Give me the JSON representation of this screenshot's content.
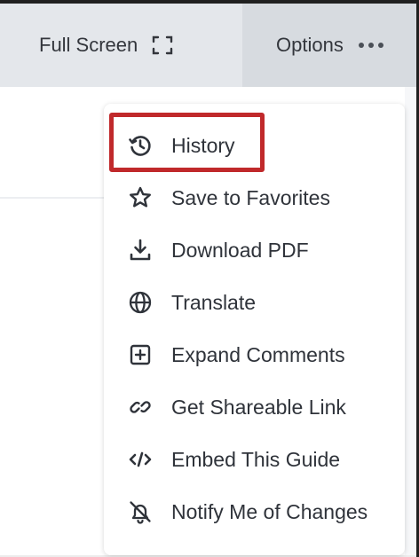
{
  "toolbar": {
    "full_screen": {
      "label": "Full Screen",
      "icon": "fullscreen-icon"
    },
    "options": {
      "label": "Options",
      "icon": "more-dots-icon"
    }
  },
  "menu": {
    "items": [
      {
        "label": "History",
        "icon": "history-icon"
      },
      {
        "label": "Save to Favorites",
        "icon": "star-icon"
      },
      {
        "label": "Download PDF",
        "icon": "download-icon"
      },
      {
        "label": "Translate",
        "icon": "globe-icon"
      },
      {
        "label": "Expand Comments",
        "icon": "plus-square-icon"
      },
      {
        "label": "Get Shareable Link",
        "icon": "link-icon"
      },
      {
        "label": "Embed This Guide",
        "icon": "code-icon"
      },
      {
        "label": "Notify Me of Changes",
        "icon": "bell-off-icon"
      }
    ]
  },
  "highlight": {
    "target": "History",
    "color": "#c0292b"
  }
}
